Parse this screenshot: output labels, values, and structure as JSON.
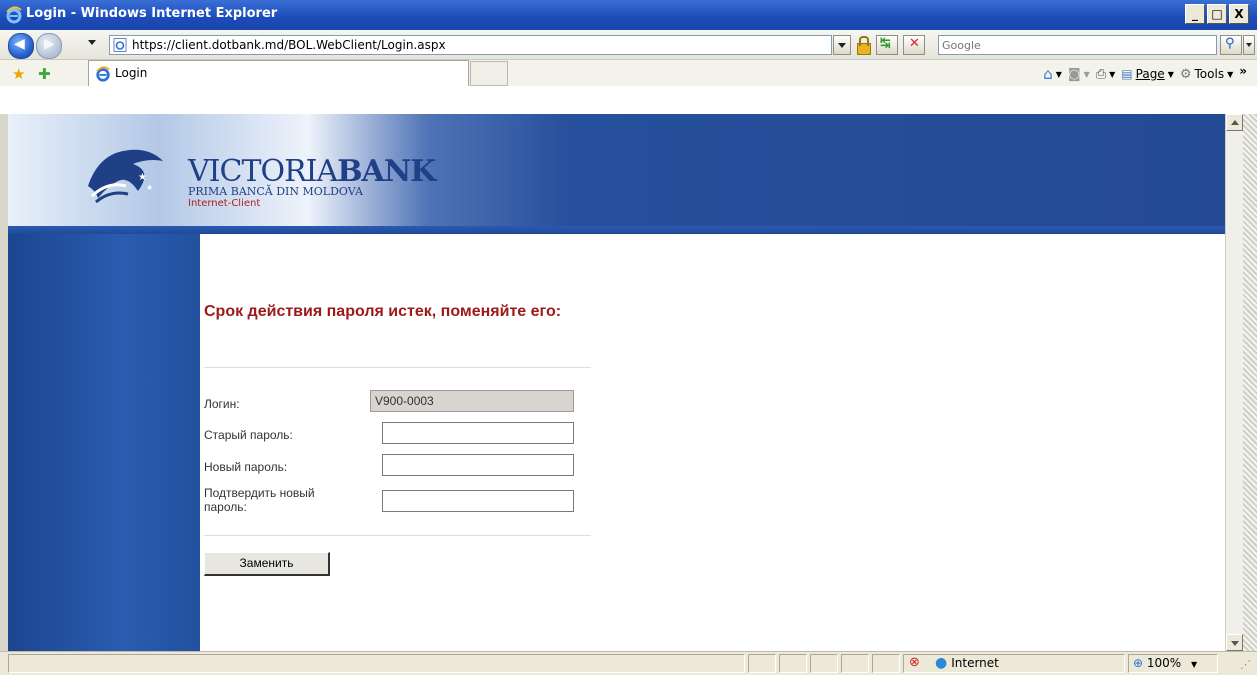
{
  "window": {
    "title": "Login - Windows Internet Explorer",
    "minimize_glyph": "_",
    "maximize_glyph": "□",
    "close_glyph": "X"
  },
  "toolbar": {
    "url": "https://client.dotbank.md/BOL.WebClient/Login.aspx",
    "search_placeholder": "Google"
  },
  "tabs": [
    {
      "label": "Login"
    }
  ],
  "commands": {
    "page_label": "Page",
    "tools_label": "Tools",
    "more_glyph": "»"
  },
  "brand": {
    "name_light": "VICTORIA",
    "name_bold": "BANK",
    "tagline": "PRIMA BANCĂ DIN MOLDOVA",
    "product": "Internet-Client"
  },
  "form": {
    "heading": "Срок действия пароля истек, поменяйте его:",
    "login_label": "Логин:",
    "login_value": "V900-0003",
    "old_password_label": "Старый пароль:",
    "new_password_label": "Новый пароль:",
    "confirm_password_label": "Подтвердить новый пароль:",
    "submit_label": "Заменить"
  },
  "status": {
    "zone": "Internet",
    "zoom": "100%"
  },
  "colors": {
    "titlebar": "#1b4bb8",
    "banner_blue": "#234a93",
    "heading_red": "#9c1a1a"
  }
}
